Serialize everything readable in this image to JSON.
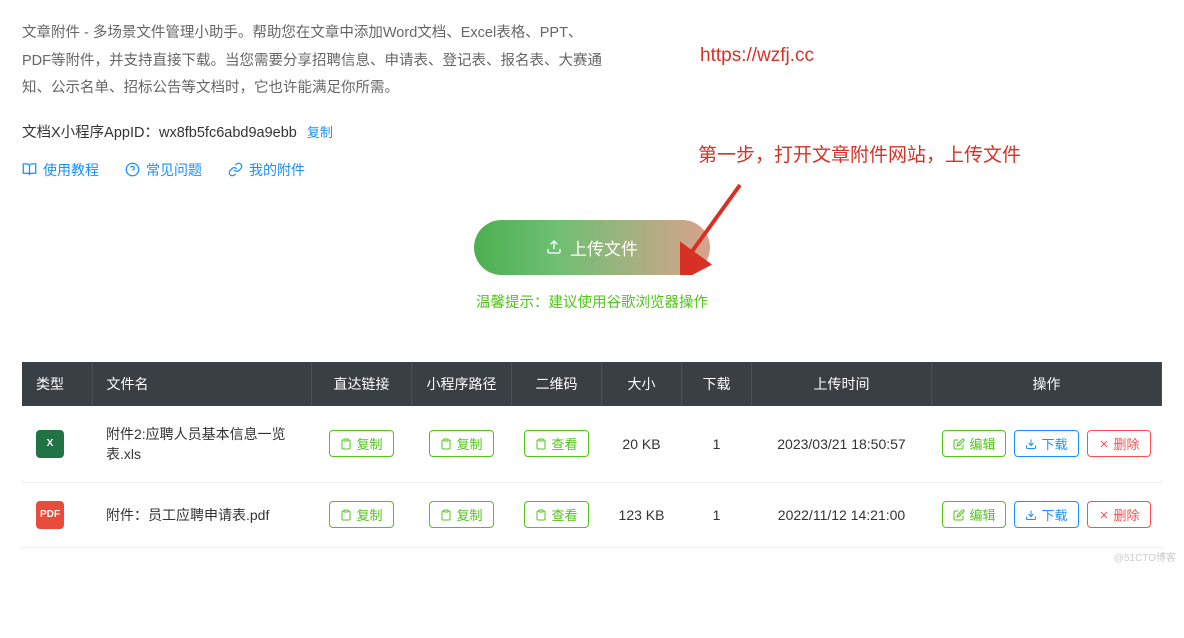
{
  "description": "文章附件 - 多场景文件管理小助手。帮助您在文章中添加Word文档、Excel表格、PPT、PDF等附件，并支持直接下载。当您需要分享招聘信息、申请表、登记表、报名表、大赛通知、公示名单、招标公告等文档时，它也许能满足你所需。",
  "appid": {
    "label": "文档X小程序AppID：",
    "value": "wx8fb5fc6abd9a9ebb",
    "copy": "复制"
  },
  "nav": {
    "tutorial": "使用教程",
    "faq": "常见问题",
    "myfiles": "我的附件"
  },
  "annotation": {
    "url": "https://wzfj.cc",
    "step": "第一步，打开文章附件网站，上传文件"
  },
  "upload": {
    "button": "上传文件",
    "tip": "温馨提示：建议使用谷歌浏览器操作"
  },
  "table": {
    "headers": {
      "type": "类型",
      "filename": "文件名",
      "directlink": "直达链接",
      "mppath": "小程序路径",
      "qrcode": "二维码",
      "size": "大小",
      "download": "下载",
      "uploadtime": "上传时间",
      "actions": "操作"
    },
    "actions": {
      "copy": "复制",
      "view": "查看",
      "edit": "编辑",
      "download": "下载",
      "delete": "删除"
    },
    "rows": [
      {
        "icon_type": "xls",
        "icon_text": "X",
        "filename": "附件2:应聘人员基本信息一览表.xls",
        "size": "20 KB",
        "download_count": "1",
        "uploadtime": "2023/03/21 18:50:57"
      },
      {
        "icon_type": "pdf",
        "icon_text": "PDF",
        "filename": "附件：员工应聘申请表.pdf",
        "size": "123 KB",
        "download_count": "1",
        "uploadtime": "2022/11/12 14:21:00"
      }
    ]
  },
  "watermark": "@51CTO博客"
}
